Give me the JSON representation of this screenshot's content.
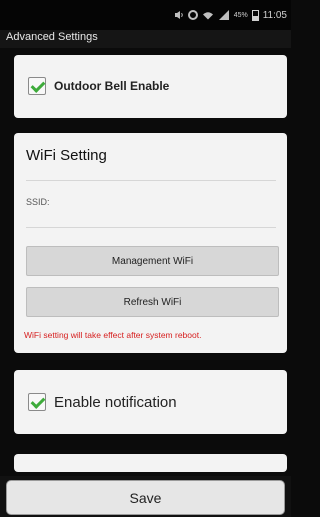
{
  "status_bar": {
    "battery": "45%",
    "time": "11:05",
    "icons": [
      "volume-icon",
      "sync-icon",
      "wifi-icon",
      "signal-icon",
      "battery-icon"
    ]
  },
  "title": "Advanced Settings",
  "outdoor_bell": {
    "label": "Outdoor Bell Enable",
    "checked": true
  },
  "wifi_setting": {
    "title": "WiFi Setting",
    "ssid_label": "SSID:",
    "management_button": "Management WiFi",
    "refresh_button": "Refresh WiFi",
    "warning": "WiFi setting will take effect after system reboot."
  },
  "notification": {
    "label": "Enable notification",
    "checked": true
  },
  "save_button": "Save",
  "colors": {
    "accent_check": "#3eab3b",
    "warning": "#d61f1f"
  }
}
